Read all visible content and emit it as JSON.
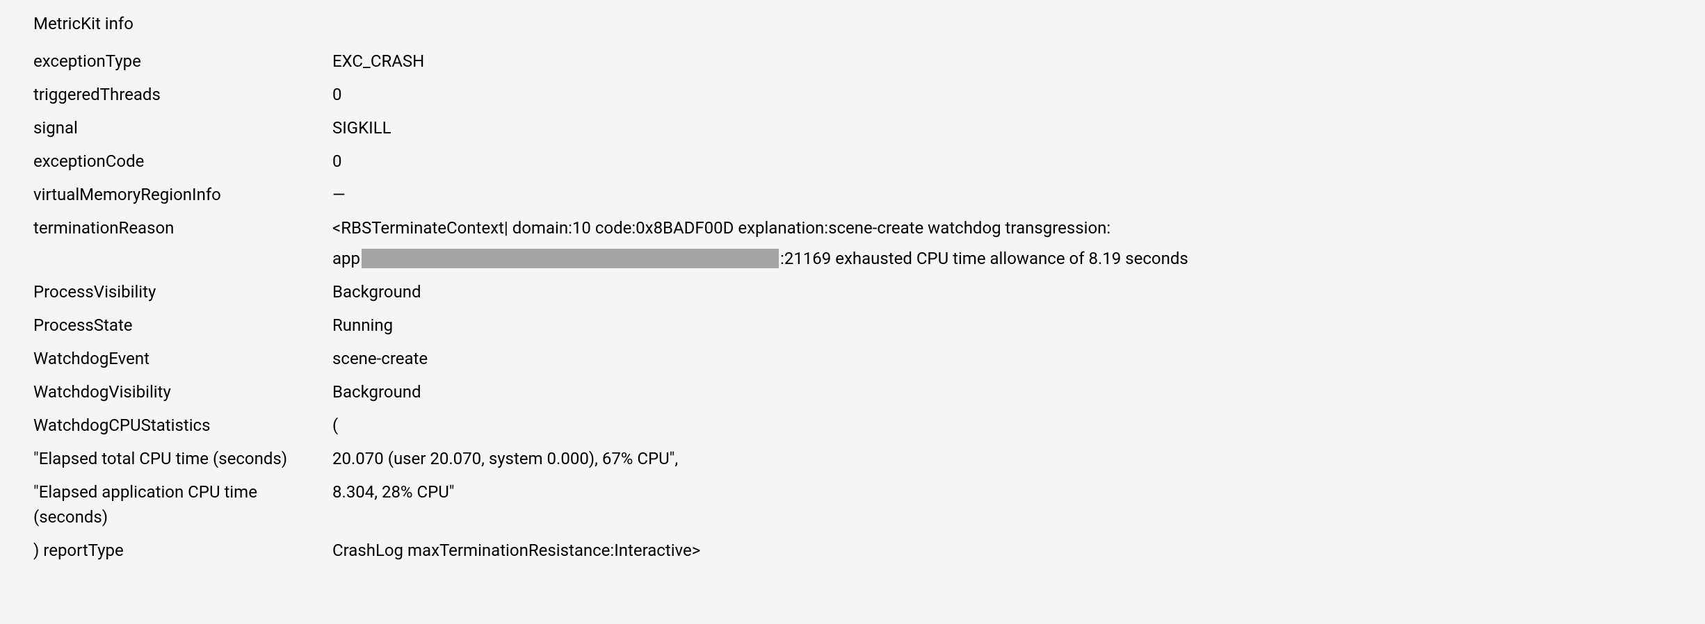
{
  "title": "MetricKit info",
  "rows": {
    "exceptionType": {
      "label": "exceptionType",
      "value": "EXC_CRASH"
    },
    "triggeredThreads": {
      "label": "triggeredThreads",
      "value": "0"
    },
    "signal": {
      "label": "signal",
      "value": "SIGKILL"
    },
    "exceptionCode": {
      "label": "exceptionCode",
      "value": "0"
    },
    "virtualMemoryRegionInfo": {
      "label": "virtualMemoryRegionInfo",
      "value": "—"
    },
    "terminationReason": {
      "label": "terminationReason",
      "line1": "<RBSTerminateContext| domain:10 code:0x8BADF00D explanation:scene-create watchdog transgression:",
      "line2_prefix": "app",
      "line2_suffix": ":21169 exhausted CPU time allowance of 8.19 seconds"
    },
    "processVisibility": {
      "label": "ProcessVisibility",
      "value": "Background"
    },
    "processState": {
      "label": "ProcessState",
      "value": "Running"
    },
    "watchdogEvent": {
      "label": "WatchdogEvent",
      "value": "scene-create"
    },
    "watchdogVisibility": {
      "label": "WatchdogVisibility",
      "value": "Background"
    },
    "watchdogCPUStatistics": {
      "label": "WatchdogCPUStatistics",
      "value": "("
    },
    "elapsedTotalCPU": {
      "label": "\"Elapsed total CPU time (seconds)",
      "value": "20.070 (user 20.070, system 0.000), 67% CPU\","
    },
    "elapsedAppCPU": {
      "label": "\"Elapsed application CPU time (seconds)",
      "value": "8.304, 28% CPU\""
    },
    "reportType": {
      "label": ") reportType",
      "value": "CrashLog maxTerminationResistance:Interactive>"
    }
  }
}
